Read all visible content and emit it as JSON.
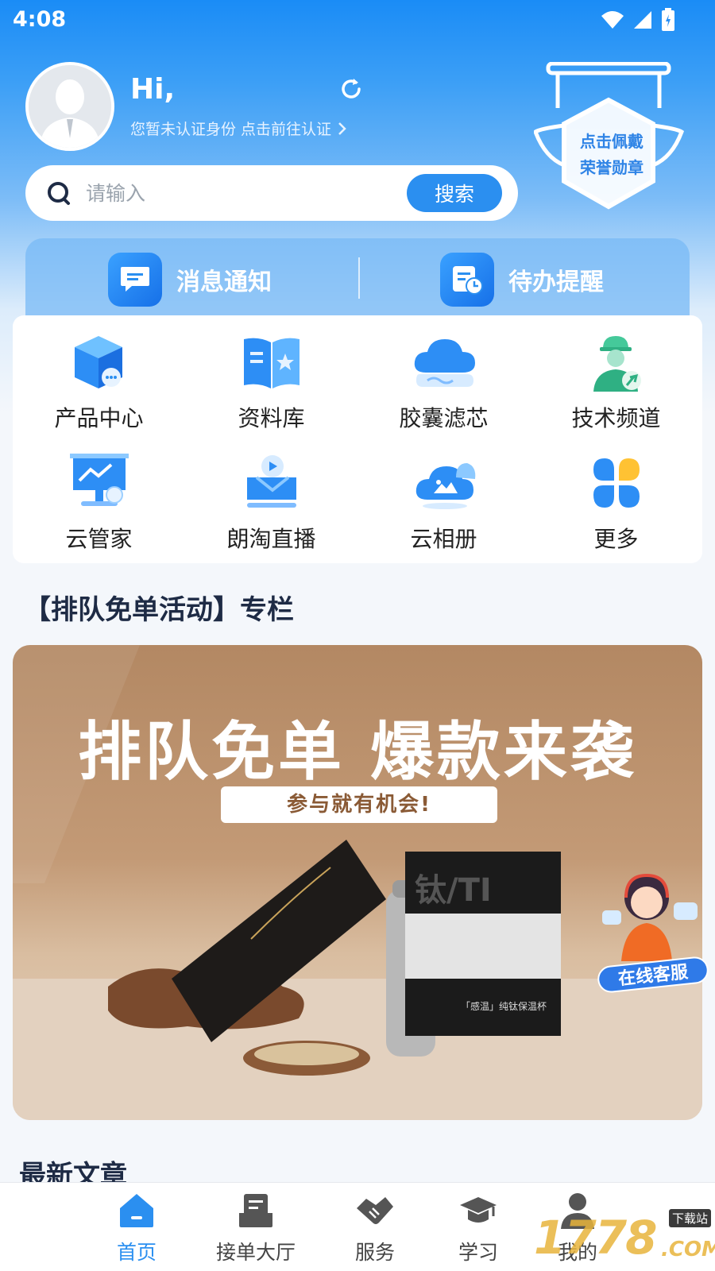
{
  "status": {
    "time": "4:08"
  },
  "profile": {
    "greeting": "Hi,",
    "verify_text": "您暂未认证身份 点击前往认证"
  },
  "search": {
    "placeholder": "请输入",
    "button": "搜索"
  },
  "badge": {
    "line1": "点击佩戴",
    "line2": "荣誉勋章"
  },
  "notify": {
    "messages": "消息通知",
    "todo": "待办提醒"
  },
  "grid": [
    {
      "label": "产品中心",
      "icon": "product-box-icon"
    },
    {
      "label": "资料库",
      "icon": "book-icon"
    },
    {
      "label": "胶囊滤芯",
      "icon": "cloud-filter-icon"
    },
    {
      "label": "技术频道",
      "icon": "engineer-icon"
    },
    {
      "label": "云管家",
      "icon": "monitor-icon"
    },
    {
      "label": "朗淘直播",
      "icon": "live-icon"
    },
    {
      "label": "云相册",
      "icon": "cloud-photo-icon"
    },
    {
      "label": "更多",
      "icon": "more-icon"
    }
  ],
  "section": {
    "title": "【排队免单活动】专栏"
  },
  "banner": {
    "headline": "排队免单  爆款来袭",
    "subline": "参与就有机会!",
    "product_box_text": "钛/TI",
    "product_caption": "「感温」纯钛保温杯"
  },
  "customer_service": {
    "label": "在线客服"
  },
  "latest": {
    "title": "最新文章"
  },
  "tabbar": [
    {
      "label": "首页",
      "icon": "home-icon",
      "active": true
    },
    {
      "label": "接单大厅",
      "icon": "order-icon",
      "active": false
    },
    {
      "label": "服务",
      "icon": "handshake-icon",
      "active": false
    },
    {
      "label": "学习",
      "icon": "graduation-cap-icon",
      "active": false
    },
    {
      "label": "我的",
      "icon": "person-icon",
      "active": false
    }
  ],
  "watermark": {
    "text": "1778",
    "sub": "下载站",
    "domain": ".COM"
  },
  "colors": {
    "primary": "#2b8ff0",
    "header_top": "#1a8cf6"
  }
}
